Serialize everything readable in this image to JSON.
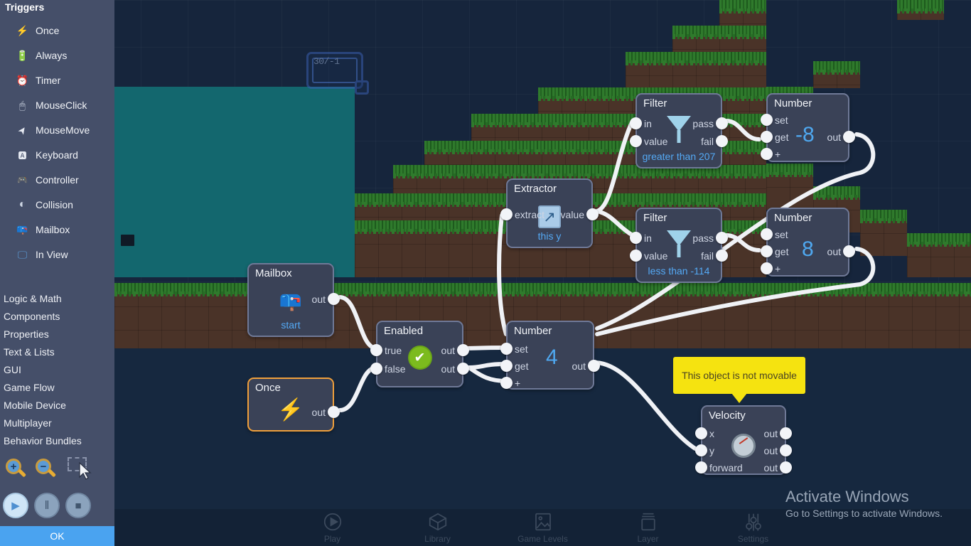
{
  "sidebar": {
    "header": "Triggers",
    "triggers": [
      {
        "label": "Once",
        "icon": "lightning-icon",
        "glyph": "⚡"
      },
      {
        "label": "Always",
        "icon": "battery-icon",
        "glyph": "🔋"
      },
      {
        "label": "Timer",
        "icon": "alarm-clock-icon",
        "glyph": "⏰"
      },
      {
        "label": "MouseClick",
        "icon": "mouse-icon",
        "glyph": "🖱"
      },
      {
        "label": "MouseMove",
        "icon": "cursor-icon",
        "glyph": "➤"
      },
      {
        "label": "Keyboard",
        "icon": "keyboard-key-icon",
        "glyph": "🅰"
      },
      {
        "label": "Controller",
        "icon": "gamepad-icon",
        "glyph": "🎮"
      },
      {
        "label": "Collision",
        "icon": "collision-icon",
        "glyph": "◐"
      },
      {
        "label": "Mailbox",
        "icon": "mailbox-icon",
        "glyph": "📪"
      },
      {
        "label": "In View",
        "icon": "monitor-icon",
        "glyph": "🖵"
      }
    ],
    "categories": [
      "Logic & Math",
      "Components",
      "Properties",
      "Text & Lists",
      "GUI",
      "Game Flow",
      "Mobile Device",
      "Multiplayer",
      "Behavior Bundles"
    ],
    "tools": [
      {
        "name": "zoom-in-icon",
        "glyph": "+"
      },
      {
        "name": "zoom-out-icon",
        "glyph": "−"
      },
      {
        "name": "marquee-select-icon",
        "glyph": ""
      }
    ],
    "transport": [
      {
        "name": "play-button",
        "glyph": "▶"
      },
      {
        "name": "pause-button",
        "glyph": "‖"
      },
      {
        "name": "stop-button",
        "glyph": "■"
      }
    ],
    "ok_label": "OK"
  },
  "canvas": {
    "selection_box": {
      "coordinate_label": "30/-1"
    },
    "tooltip": {
      "text": "This object is not movable"
    }
  },
  "nodes": [
    {
      "id": "mailbox",
      "title": "Mailbox",
      "subtitle": "start",
      "icon": "mailbox-icon",
      "glyph": "📪",
      "inputs": [],
      "outputs": [
        "out"
      ],
      "selected": false
    },
    {
      "id": "once",
      "title": "Once",
      "subtitle": "",
      "icon": "lightning-icon",
      "glyph": "⚡",
      "inputs": [],
      "outputs": [
        "out"
      ],
      "selected": true
    },
    {
      "id": "enabled",
      "title": "Enabled",
      "subtitle": "",
      "icon": "green-check-icon",
      "glyph": "✔",
      "inputs": [
        "true",
        "false"
      ],
      "outputs": [
        "out",
        "out"
      ],
      "selected": false
    },
    {
      "id": "number-4",
      "title": "Number",
      "value": "4",
      "subtitle": "",
      "icon": "number-icon",
      "inputs": [
        "set",
        "get",
        "+"
      ],
      "outputs": [
        "out"
      ],
      "selected": false
    },
    {
      "id": "extractor",
      "title": "Extractor",
      "subtitle": "this y",
      "icon": "extract-arrow-icon",
      "glyph": "↗",
      "inputs": [
        "extract"
      ],
      "outputs": [
        "value"
      ],
      "selected": false
    },
    {
      "id": "filter-greater",
      "title": "Filter",
      "subtitle": "greater than 207",
      "icon": "funnel-icon",
      "inputs": [
        "in",
        "value"
      ],
      "outputs": [
        "pass",
        "fail"
      ],
      "selected": false
    },
    {
      "id": "filter-less",
      "title": "Filter",
      "subtitle": "less than -114",
      "icon": "funnel-icon",
      "inputs": [
        "in",
        "value"
      ],
      "outputs": [
        "pass",
        "fail"
      ],
      "selected": false
    },
    {
      "id": "number-minus8",
      "title": "Number",
      "value": "-8",
      "subtitle": "",
      "icon": "number-icon",
      "inputs": [
        "set",
        "get",
        "+"
      ],
      "outputs": [
        "out"
      ],
      "selected": false
    },
    {
      "id": "number-8",
      "title": "Number",
      "value": "8",
      "subtitle": "",
      "icon": "number-icon",
      "inputs": [
        "set",
        "get",
        "+"
      ],
      "outputs": [
        "out"
      ],
      "selected": false
    },
    {
      "id": "velocity",
      "title": "Velocity",
      "subtitle": "",
      "icon": "speedometer-icon",
      "inputs": [
        "x",
        "y",
        "forward"
      ],
      "outputs": [
        "out",
        "out",
        "out"
      ],
      "selected": false
    }
  ],
  "bottom_bar": [
    {
      "label": "Play",
      "icon": "play-circle-icon"
    },
    {
      "label": "Library",
      "icon": "cube-icon"
    },
    {
      "label": "Game Levels",
      "icon": "image-icon"
    },
    {
      "label": "Layer",
      "icon": "layers-icon"
    },
    {
      "label": "Settings",
      "icon": "sliders-icon"
    }
  ],
  "watermark": {
    "line1": "Activate Windows",
    "line2": "Go to Settings to activate Windows."
  },
  "colors": {
    "accent_blue": "#4fa8f0",
    "selected_node": "#f0a03c",
    "tooltip_yellow": "#f5e310",
    "node_body": "#3a4257",
    "sidebar": "#454f69",
    "water": "#13676e",
    "grass": "#2f7a2c",
    "dirt": "#4a3328"
  }
}
